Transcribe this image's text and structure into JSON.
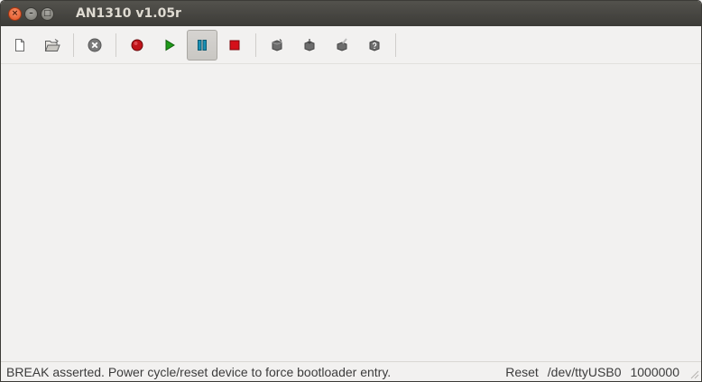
{
  "window": {
    "title": "AN1310 v1.05r",
    "controls": {
      "close": "×",
      "minimize": "–",
      "maximize": "□"
    }
  },
  "toolbar": {
    "items": [
      {
        "name": "new-icon"
      },
      {
        "name": "open-folder-icon"
      },
      {
        "name": "abort-icon"
      },
      {
        "name": "record-icon",
        "color": "#c0141a"
      },
      {
        "name": "run-icon",
        "color": "#1e9a18"
      },
      {
        "name": "pause-icon",
        "color": "#1a8fb3",
        "active": true
      },
      {
        "name": "stop-icon",
        "color": "#d4101a"
      },
      {
        "name": "program-device-icon"
      },
      {
        "name": "read-device-icon"
      },
      {
        "name": "erase-device-icon"
      },
      {
        "name": "verify-device-icon"
      }
    ]
  },
  "statusbar": {
    "message": "BREAK asserted. Power cycle/reset device to force bootloader entry.",
    "mode": "Reset",
    "port": "/dev/ttyUSB0",
    "baud": "1000000"
  }
}
